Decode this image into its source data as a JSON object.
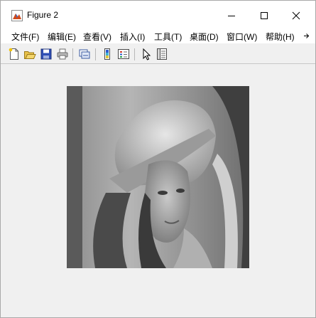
{
  "window": {
    "title": "Figure 2",
    "app_icon": "matlab-figure-icon",
    "controls": [
      "minimize-icon",
      "maximize-icon",
      "close-icon"
    ]
  },
  "menubar": {
    "items": [
      {
        "label": "文件(F)"
      },
      {
        "label": "编辑(E)"
      },
      {
        "label": "查看(V)"
      },
      {
        "label": "插入(I)"
      },
      {
        "label": "工具(T)"
      },
      {
        "label": "桌面(D)"
      },
      {
        "label": "窗口(W)"
      },
      {
        "label": "帮助(H)"
      }
    ],
    "overflow_icon": "chevron-right-icon"
  },
  "toolbar": {
    "buttons": [
      "new-figure-icon",
      "open-file-icon",
      "save-icon",
      "print-icon",
      "link-plot-icon",
      "colorbar-icon",
      "legend-icon",
      "pointer-icon",
      "property-editor-icon"
    ]
  },
  "figure": {
    "image": "grayscale-portrait-image",
    "background": "#f0f0f0"
  }
}
